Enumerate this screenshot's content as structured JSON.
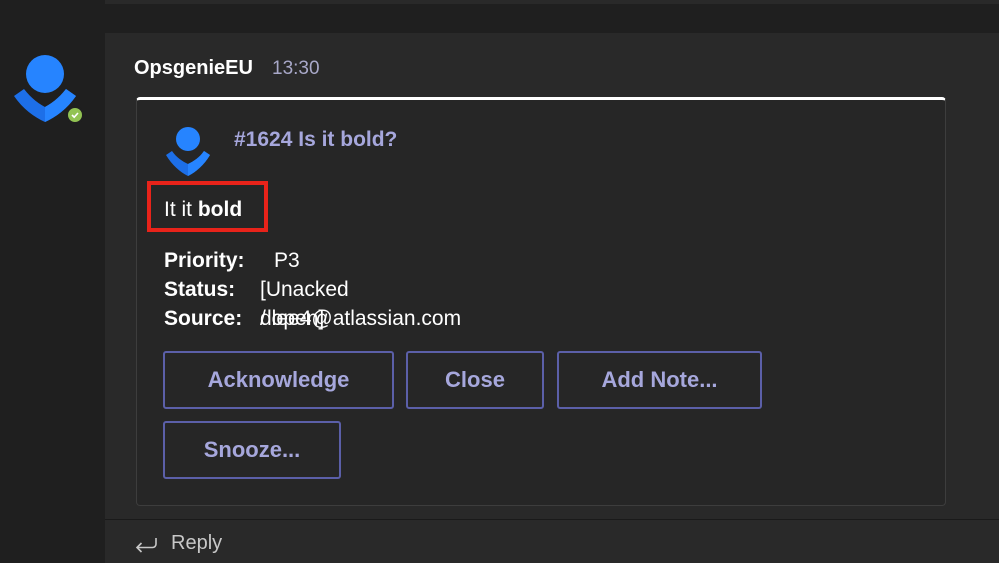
{
  "message": {
    "sender": "OpsgenieEU",
    "time": "13:30"
  },
  "card": {
    "title": "#1624 Is it bold?",
    "body_plain": "It it ",
    "body_bold": "bold",
    "facts": [
      {
        "key": "Priority:",
        "value": "P3"
      },
      {
        "key": "Status:",
        "value": "[Unacked / open]"
      },
      {
        "key": "Source:",
        "value": "dlee4@atlassian.com"
      }
    ],
    "actions": {
      "acknowledge": "Acknowledge",
      "close": "Close",
      "add_note": "Add Note...",
      "snooze": "Snooze..."
    }
  },
  "reply": {
    "label": "Reply"
  },
  "icons": {
    "avatar": "opsgenie-logo-icon",
    "presence": "available-check-icon",
    "reply": "reply-arrow-icon"
  },
  "colors": {
    "accent": "#a6a7dc",
    "button_border": "#5b5fa8",
    "highlight": "#e8231a",
    "presence": "#92c353",
    "logo_blue": "#2684ff"
  }
}
